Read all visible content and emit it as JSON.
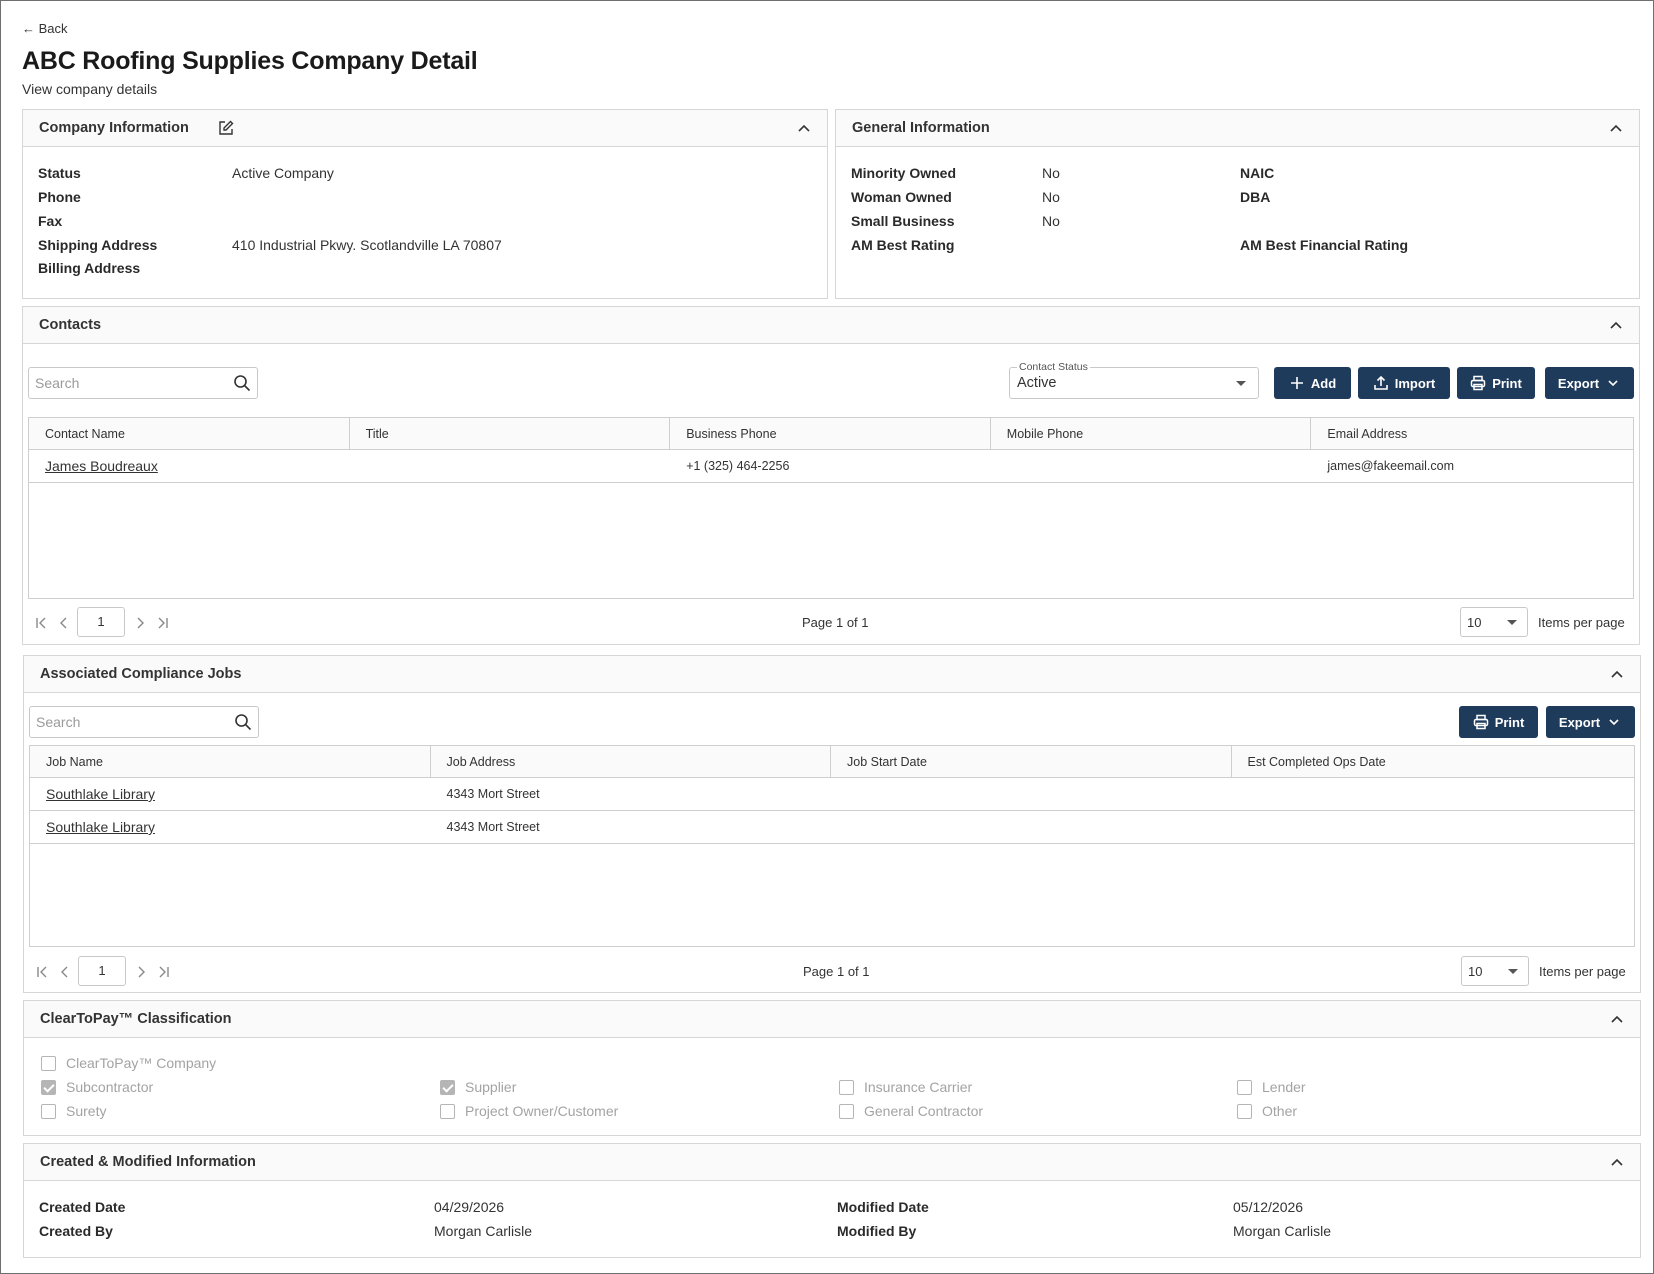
{
  "nav": {
    "back": "← Back"
  },
  "page": {
    "title": "ABC Roofing Supplies Company Detail",
    "subtitle": "View company details"
  },
  "company_info": {
    "title": "Company Information",
    "fields": [
      {
        "label": "Status",
        "value": "Active Company"
      },
      {
        "label": "Phone",
        "value": ""
      },
      {
        "label": "Fax",
        "value": ""
      },
      {
        "label": "Shipping Address",
        "value": "410 Industrial Pkwy. Scotlandville LA 70807"
      },
      {
        "label": "Billing Address",
        "value": ""
      }
    ]
  },
  "general_info": {
    "title": "General Information",
    "left": [
      {
        "label": "Minority Owned",
        "value": "No"
      },
      {
        "label": "Woman Owned",
        "value": "No"
      },
      {
        "label": "Small Business",
        "value": "No"
      },
      {
        "label": "AM Best Rating",
        "value": ""
      }
    ],
    "right": [
      {
        "label": "NAIC",
        "value": ""
      },
      {
        "label": "DBA",
        "value": ""
      },
      {
        "label": "AM Best Financial Rating",
        "value": ""
      }
    ]
  },
  "contacts": {
    "title": "Contacts",
    "search_placeholder": "Search",
    "status_label": "Contact Status",
    "status_value": "Active",
    "buttons": {
      "add": "Add",
      "import": "Import",
      "print": "Print",
      "export": "Export"
    },
    "columns": [
      "Contact Name",
      "Title",
      "Business Phone",
      "Mobile Phone",
      "Email Address"
    ],
    "rows": [
      {
        "name": "James Boudreaux",
        "title": "",
        "business_phone": "+1 (325) 464-2256",
        "mobile_phone": "",
        "email": "james@fakeemail.com"
      }
    ],
    "pager": {
      "page": "1",
      "page_text": "Page 1 of 1",
      "per_page": "10",
      "per_page_label": "Items per page"
    }
  },
  "jobs": {
    "title": "Associated Compliance Jobs",
    "search_placeholder": "Search",
    "buttons": {
      "print": "Print",
      "export": "Export"
    },
    "columns": [
      "Job Name",
      "Job Address",
      "Job Start Date",
      "Est Completed Ops Date"
    ],
    "rows": [
      {
        "name": "Southlake Library",
        "address": "4343 Mort Street",
        "start": "",
        "est": ""
      },
      {
        "name": "Southlake Library",
        "address": "4343 Mort Street",
        "start": "",
        "est": ""
      }
    ],
    "pager": {
      "page": "1",
      "page_text": "Page 1 of 1",
      "per_page": "10",
      "per_page_label": "Items per page"
    }
  },
  "classification": {
    "title": "ClearToPay™ Classification",
    "items": [
      {
        "label": "ClearToPay™ Company",
        "checked": false
      },
      {
        "label": "Subcontractor",
        "checked": true
      },
      {
        "label": "Surety",
        "checked": false
      },
      {
        "label": "Supplier",
        "checked": true
      },
      {
        "label": "Project Owner/Customer",
        "checked": false
      },
      {
        "label": "Insurance Carrier",
        "checked": false
      },
      {
        "label": "General Contractor",
        "checked": false
      },
      {
        "label": "Lender",
        "checked": false
      },
      {
        "label": "Other",
        "checked": false
      }
    ]
  },
  "created_modified": {
    "title": "Created & Modified Information",
    "created_date_label": "Created Date",
    "created_date": "04/29/2026",
    "created_by_label": "Created By",
    "created_by": "Morgan Carlisle",
    "modified_date_label": "Modified Date",
    "modified_date": "05/12/2026",
    "modified_by_label": "Modified By",
    "modified_by": "Morgan Carlisle"
  }
}
